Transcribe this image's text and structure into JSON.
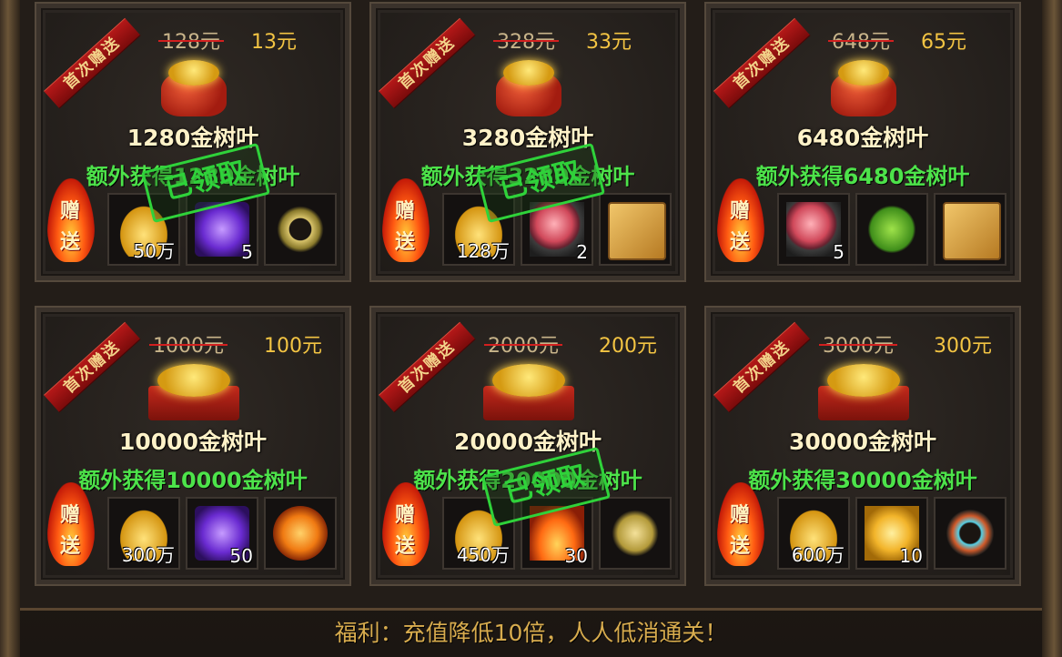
{
  "badge_text": "首次赠送",
  "gift_label": [
    "赠",
    "送"
  ],
  "footer": "福利：充值降低10倍，人人低消通关！",
  "packages": [
    {
      "orig": "128元",
      "price": "13元",
      "amount": "1280金树叶",
      "bonus": "额外获得1280金树叶",
      "claimed": true,
      "claimed_text": "已领取",
      "items": [
        {
          "icon": "gold-ingot-icon",
          "qty": "50万"
        },
        {
          "icon": "purple-gem-icon",
          "qty": "5"
        },
        {
          "icon": "gold-ring-icon",
          "qty": ""
        }
      ]
    },
    {
      "orig": "328元",
      "price": "33元",
      "amount": "3280金树叶",
      "bonus": "额外获得3280金树叶",
      "claimed": true,
      "claimed_text": "已领取",
      "items": [
        {
          "icon": "gold-ingot-icon",
          "qty": "128万"
        },
        {
          "icon": "red-pearl-icon",
          "qty": "2"
        },
        {
          "icon": "scroll-icon",
          "qty": ""
        }
      ]
    },
    {
      "orig": "648元",
      "price": "65元",
      "amount": "6480金树叶",
      "bonus": "额外获得6480金树叶",
      "claimed": false,
      "claimed_text": "",
      "items": [
        {
          "icon": "red-pearl-icon",
          "qty": "5"
        },
        {
          "icon": "green-leaf-icon",
          "qty": ""
        },
        {
          "icon": "scroll-icon",
          "qty": ""
        }
      ]
    },
    {
      "orig": "1000元",
      "price": "100元",
      "amount": "10000金树叶",
      "bonus": "额外获得10000金树叶",
      "claimed": false,
      "claimed_text": "",
      "items": [
        {
          "icon": "gold-ingot-icon",
          "qty": "300万"
        },
        {
          "icon": "purple-gem-icon",
          "qty": "50"
        },
        {
          "icon": "fire-orb-icon",
          "qty": ""
        }
      ]
    },
    {
      "orig": "2000元",
      "price": "200元",
      "amount": "20000金树叶",
      "bonus": "额外获得20000金树叶",
      "claimed": true,
      "claimed_text": "已领取",
      "items": [
        {
          "icon": "gold-ingot-icon",
          "qty": "450万"
        },
        {
          "icon": "flame-crystal-icon",
          "qty": "30"
        },
        {
          "icon": "golden-moth-icon",
          "qty": ""
        }
      ]
    },
    {
      "orig": "3000元",
      "price": "300元",
      "amount": "30000金树叶",
      "bonus": "额外获得30000金树叶",
      "claimed": false,
      "claimed_text": "",
      "items": [
        {
          "icon": "gold-ingot-icon",
          "qty": "600万"
        },
        {
          "icon": "gold-crystal-icon",
          "qty": "10"
        },
        {
          "icon": "jeweled-bracelet-icon",
          "qty": ""
        }
      ]
    }
  ]
}
